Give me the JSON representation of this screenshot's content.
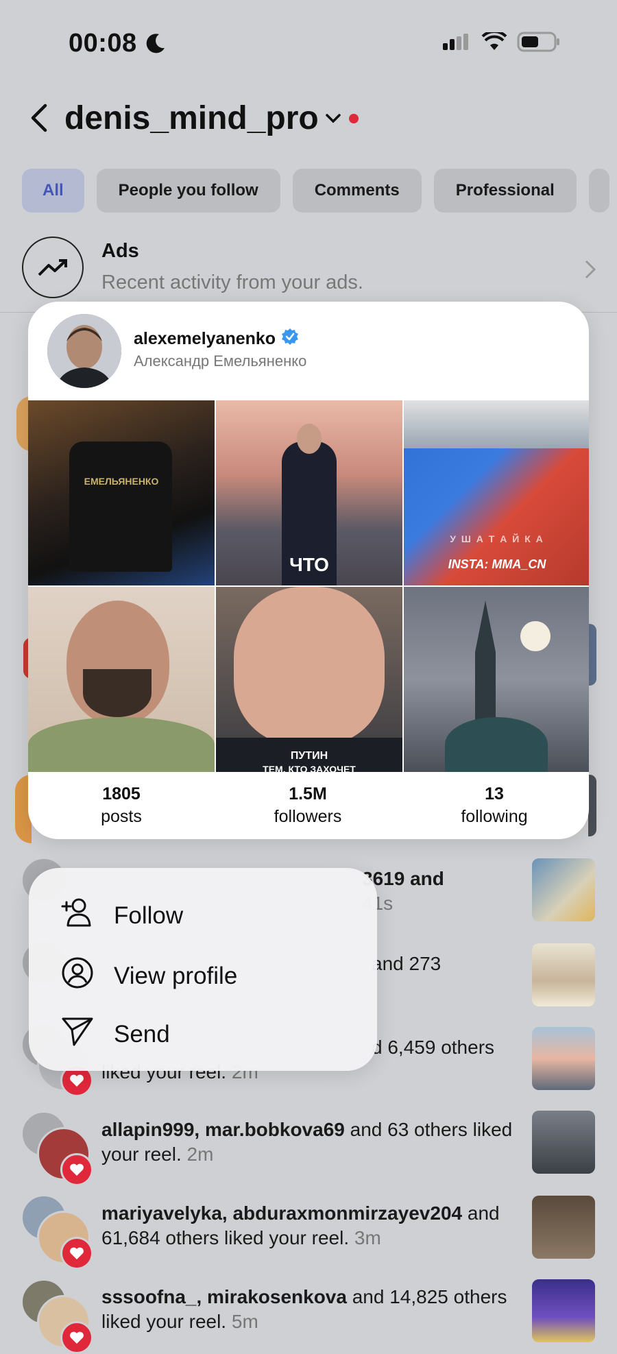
{
  "status_bar": {
    "time": "00:08"
  },
  "header": {
    "username": "denis_mind_pro"
  },
  "filters": [
    "All",
    "People you follow",
    "Comments",
    "Professional"
  ],
  "ads": {
    "title": "Ads",
    "subtitle": "Recent activity from your ads."
  },
  "notifications": [
    {
      "partial_text": "3619 and",
      "partial_time": "41s"
    },
    {
      "partial_text": "and 273"
    },
    {
      "partial_text": "d 6,459 others",
      "partial_line2": "liked your reel.",
      "time": "2m"
    },
    {
      "users": "allapin999, mar.bobkova69",
      "rest": " and 63 others liked your reel.",
      "time": "2m"
    },
    {
      "users": "mariyavelyka, abduraxmonmirzayev204",
      "rest": " and 61,684 others liked your reel.",
      "time": "3m"
    },
    {
      "users": "sssoofna_, mirakosenkova",
      "rest": " and 14,825 others liked your reel.",
      "time": "5m"
    }
  ],
  "profile_card": {
    "handle": "alexemelyanenko",
    "verified": true,
    "full_name": "Александр Емельяненко",
    "grid_overlays": {
      "tshirt": "ЕМЕЛЬЯНЕНКО",
      "putin_walk": "ЧТО",
      "wrestling_top": "У Ш А Т А Й К А",
      "wrestling": "INSTA: MMA_CN",
      "putin_face_1": "ПУТИН",
      "putin_face_2": "ТЕМ, КТО ЗАХОЧЕТ"
    },
    "stats": [
      {
        "value": "1805",
        "label": "posts"
      },
      {
        "value": "1.5M",
        "label": "followers"
      },
      {
        "value": "13",
        "label": "following"
      }
    ]
  },
  "menu": [
    {
      "label": "Follow",
      "icon": "add-person-icon"
    },
    {
      "label": "View profile",
      "icon": "profile-icon"
    },
    {
      "label": "Send",
      "icon": "send-icon"
    }
  ],
  "colors": {
    "accent": "#4557b4",
    "heart": "#e0283b",
    "verified": "#3897f0"
  }
}
